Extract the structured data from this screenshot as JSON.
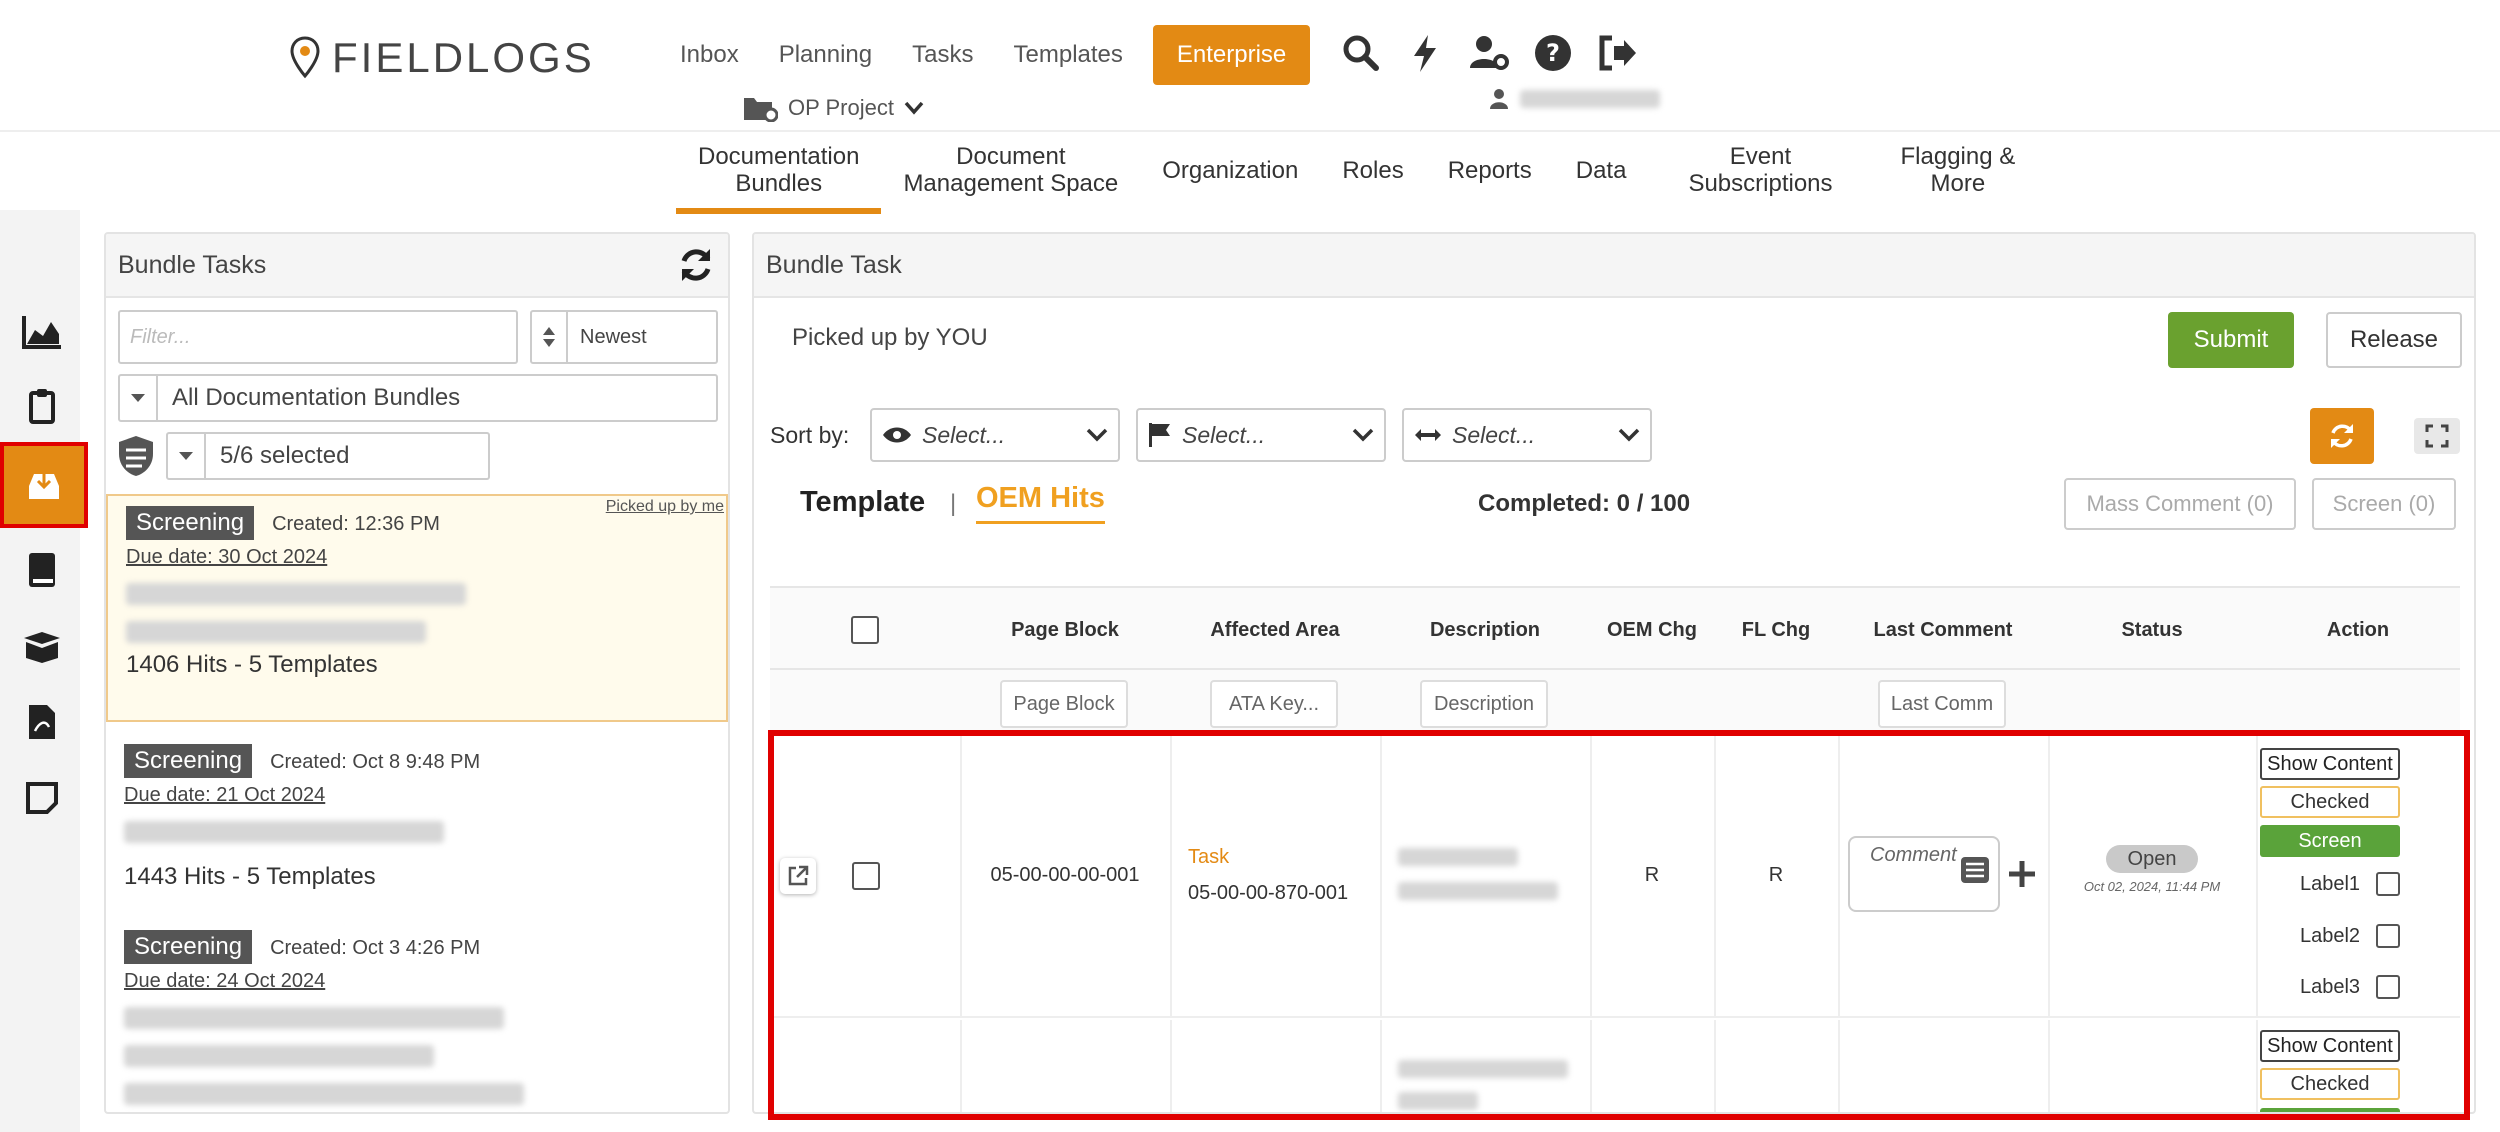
{
  "header": {
    "logo_text": "FIELDLOGS",
    "nav": [
      "Inbox",
      "Planning",
      "Tasks",
      "Templates"
    ],
    "enterprise_label": "Enterprise",
    "project_label": "OP Project"
  },
  "subnav": [
    {
      "label": "Documentation\nBundles",
      "active": true
    },
    {
      "label": "Document\nManagement Space",
      "active": false
    },
    {
      "label": "Organization",
      "active": false
    },
    {
      "label": "Roles",
      "active": false
    },
    {
      "label": "Reports",
      "active": false
    },
    {
      "label": "Data",
      "active": false
    },
    {
      "label": "Event\nSubscriptions",
      "active": false
    },
    {
      "label": "Flagging &\nMore",
      "active": false
    }
  ],
  "left_panel": {
    "title": "Bundle Tasks",
    "filter_placeholder": "Filter...",
    "sort_order": "Newest",
    "bundle_filter": "All Documentation Bundles",
    "status_filter": "5/6 selected",
    "tasks": [
      {
        "badge": "Screening",
        "created": "Created: 12:36 PM",
        "due": "Due date: 30 Oct 2024",
        "hits": "1406 Hits - 5 Templates",
        "picked": "Picked up by me"
      },
      {
        "badge": "Screening",
        "created": "Created: Oct 8 9:48 PM",
        "due": "Due date: 21 Oct 2024",
        "hits": "1443 Hits - 5 Templates"
      },
      {
        "badge": "Screening",
        "created": "Created: Oct 3 4:26 PM",
        "due": "Due date: 24 Oct 2024"
      }
    ]
  },
  "right_panel": {
    "title": "Bundle Task",
    "picked_text": "Picked up by YOU",
    "submit": "Submit",
    "release": "Release",
    "sort_label": "Sort by:",
    "selects": [
      "Select...",
      "Select...",
      "Select..."
    ],
    "tab_template": "Template",
    "tab_sep": "|",
    "tab_oem": "OEM Hits",
    "completed_label": "Completed:",
    "completed_value": "0 / 100",
    "mass_comment": "Mass Comment (0)",
    "screen_btn": "Screen (0)",
    "columns": [
      "Page Block",
      "Affected Area",
      "Description",
      "OEM Chg",
      "FL Chg",
      "Last Comment",
      "Status",
      "Action"
    ],
    "filters": {
      "page_block": "Page Block",
      "ata_key": "ATA Key...",
      "description": "Description",
      "last_comment": "Last Comm"
    },
    "row1": {
      "page_block": "05-00-00-00-001",
      "area_type": "Task",
      "area_code": "05-00-00-870-001",
      "oem_chg": "R",
      "fl_chg": "R",
      "comment_placeholder": "Comment ..",
      "status": "Open",
      "status_date": "Oct 02, 2024, 11:44 PM",
      "show_content": "Show Content",
      "checked": "Checked",
      "screen": "Screen",
      "labels": [
        "Label1",
        "Label2",
        "Label3"
      ]
    },
    "row2": {
      "show_content": "Show Content",
      "checked": "Checked"
    }
  },
  "colors": {
    "accent": "#e38a14",
    "submit": "#6aa12f",
    "highlight_outline": "#e00000"
  }
}
